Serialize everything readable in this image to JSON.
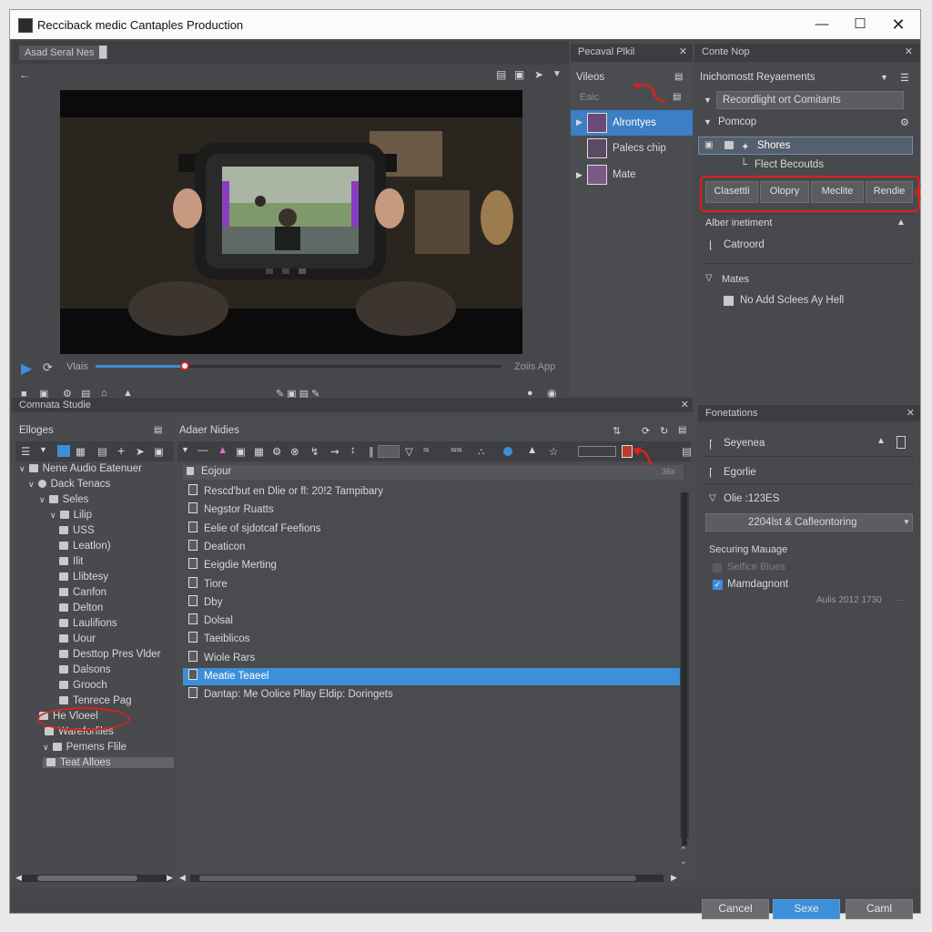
{
  "window": {
    "title": "Recciback medic Cantaples Production"
  },
  "preview": {
    "tab": "Asad Seral Nes",
    "timecode": "Vlais",
    "app_label": "Zoiis App",
    "progress": 0.22
  },
  "project_panel": {
    "title": "Pecaval Plkil",
    "header": "Vileos",
    "subheader": "Eaic",
    "items": [
      "Alrontyes",
      "Palecs chip",
      "Mate"
    ]
  },
  "inspector": {
    "title": "Conte Nop",
    "dropdown": "Inichomostt Reyaements",
    "section1": "Recordlight ort Comitants",
    "section2": "Pomcop",
    "tree_item": "Shores",
    "tree_sub": "Flect Becoutds",
    "buttons": [
      "Clasettli",
      "Olopry",
      "Meclite",
      "Rendie"
    ],
    "adjust_label": "Alber inetiment",
    "adjust_item": "Catroord",
    "mates_label": "Mates",
    "checkbox_label": "No Add Sclees Ay Hell"
  },
  "browser": {
    "title": "Comnata Studie",
    "left_title": "Elloges",
    "tree": [
      "Nene Audio Eatenuer",
      "Dack Tenacs",
      "Seles",
      "Lilip",
      "USS",
      "Leatlon)",
      "Ilit",
      "Llibtesy",
      "Canfon",
      "Delton",
      "Laulifions",
      "Uour",
      "Desttop Pres Vlder",
      "Dalsons",
      "Grooch",
      "Tenrece Pag",
      "He Vloeel",
      "Wareforfiles",
      "Pemens Flile",
      "Teat Alloes"
    ],
    "list_title": "Adaer Nidies",
    "column": "Eojour",
    "column_right": "36s",
    "files": [
      "Rescd'but en Dlie or fl: 20!2 Tampibary",
      "Negstor Ruatts",
      "Eelie of sjdotcaf Feefions",
      "Deaticon",
      "Eeigdie Merting",
      "Tiore",
      "Dby",
      "Dolsal",
      "Taeiblicos",
      "Wiole Rars",
      "Meatie Teaeel",
      "Dantap: Me Oolice Pllay Eldip: Doringets"
    ]
  },
  "properties": {
    "title": "Fonetations",
    "rows": [
      "Seyenea",
      "Egorlie",
      "Olie :123ES"
    ],
    "dropdown": "2204lst & Cafleontoring",
    "section": "Securing Mauage",
    "disabled_option": "Selfice Blues",
    "checked_option": "Mamdagnont",
    "footer": "Aulis 2012 1730"
  },
  "footer_buttons": {
    "cancel": "Cancel",
    "save": "Sexe",
    "cancel2": "Caml"
  },
  "colors": {
    "accent": "#3d8fd9",
    "highlight": "#d9221e",
    "panel": "#46474a"
  }
}
